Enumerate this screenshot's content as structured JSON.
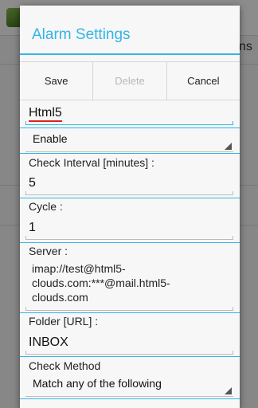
{
  "background": {
    "partial_label": "ns"
  },
  "dialog": {
    "title": "Alarm Settings",
    "buttons": {
      "save": "Save",
      "delete": "Delete",
      "cancel": "Cancel"
    },
    "name_value": "Html5",
    "status_value": "Enable",
    "interval": {
      "label": "Check Interval [minutes] :",
      "value": "5"
    },
    "cycle": {
      "label": "Cycle :",
      "value": "1"
    },
    "server": {
      "label": "Server :",
      "value": "imap://test@html5-clouds.com:***@mail.html5-clouds.com"
    },
    "folder": {
      "label": "Folder [URL] :",
      "value": "INBOX"
    },
    "check_method": {
      "label": "Check Method",
      "value": "Match any of the following"
    }
  },
  "colors": {
    "accent": "#33b5e5",
    "disabled_text": "#b8b8b8",
    "spellcheck": "#e02020"
  }
}
